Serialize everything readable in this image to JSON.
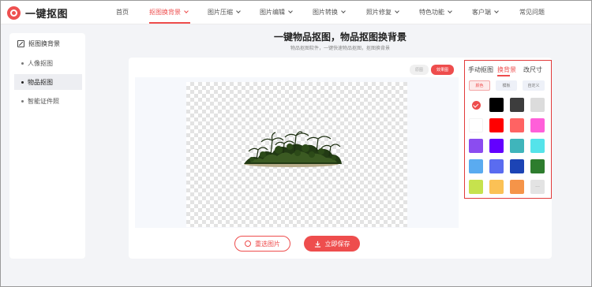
{
  "header": {
    "logo_text": "一键抠图",
    "nav": [
      {
        "label": "首页"
      },
      {
        "label": "抠图换背景"
      },
      {
        "label": "图片压缩"
      },
      {
        "label": "图片编辑"
      },
      {
        "label": "图片转换"
      },
      {
        "label": "照片修复"
      },
      {
        "label": "特色功能"
      },
      {
        "label": "客户端"
      },
      {
        "label": "常见问题"
      }
    ],
    "active_nav": "抠图换背景"
  },
  "sidebar": {
    "title": "抠图换背景",
    "items": [
      {
        "label": "人像抠图"
      },
      {
        "label": "物品抠图"
      },
      {
        "label": "智能证件照"
      }
    ],
    "active_item": "物品抠图"
  },
  "main": {
    "title": "一键物品抠图，物品抠图换背景",
    "subtitle": "物品抠图软件，一键快速物品抠图，抠图换背景",
    "compare": {
      "before": "原图",
      "after": "效果图"
    },
    "buttons": {
      "reselect": "重选图片",
      "save": "立即保存"
    }
  },
  "panel": {
    "tabs": [
      {
        "label": "手动抠图"
      },
      {
        "label": "换背景"
      },
      {
        "label": "改尺寸"
      }
    ],
    "active_tab": "换背景",
    "subtabs": [
      {
        "label": "颜色"
      },
      {
        "label": "模板"
      },
      {
        "label": "自定义"
      }
    ],
    "active_subtab": "颜色",
    "swatches": [
      "transparent-selected",
      "#000000",
      "#3d3d3d",
      "#dcdcdc",
      "#ffffff",
      "#ff0000",
      "#ff6363",
      "#ff5fd9",
      "#8b4cf0",
      "#6300ff",
      "#3fb5bb",
      "#55e3ea",
      "#5aabf0",
      "#5a6cf0",
      "#1c44b5",
      "#2e7d2e",
      "#c6e24d",
      "#fbc155",
      "#f59449",
      "more"
    ],
    "more_label": "···"
  },
  "colors": {
    "accent": "#ee4d4d"
  }
}
